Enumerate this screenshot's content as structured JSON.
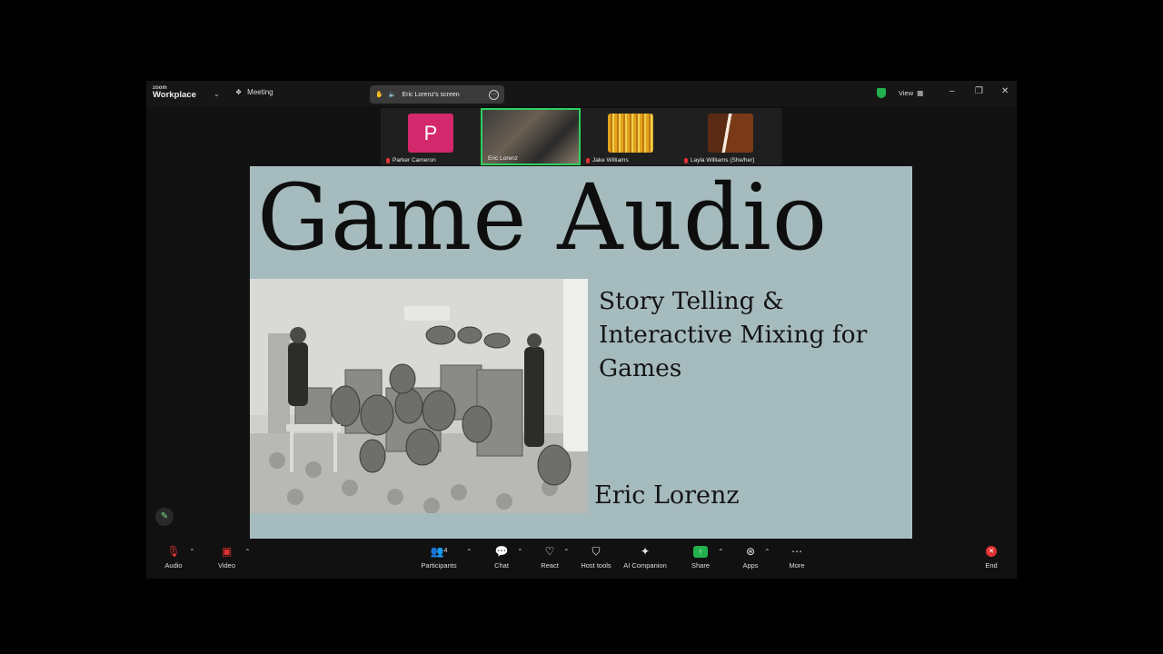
{
  "app": {
    "logo_top": "zoom",
    "logo_bottom": "Workplace",
    "meeting_label": "Meeting"
  },
  "share_pill": {
    "label": "Eric Lorenz's screen"
  },
  "view": {
    "label": "View"
  },
  "participants": [
    {
      "name": "Parker Cameron",
      "initial": "P",
      "muted": true
    },
    {
      "name": "Eric Lorenz",
      "muted": false,
      "active": true
    },
    {
      "name": "Jake Williams",
      "muted": true
    },
    {
      "name": "Layla Williams (She/her)",
      "muted": true
    }
  ],
  "slide": {
    "title": "Game Audio",
    "subtitle": "Story Telling & Interactive Mixing for Games",
    "author": "Eric Lorenz"
  },
  "toolbar": {
    "audio": "Audio",
    "video": "Video",
    "participants": "Participants",
    "participants_count": "4",
    "chat": "Chat",
    "react": "React",
    "host_tools": "Host tools",
    "ai_companion": "AI Companion",
    "share": "Share",
    "apps": "Apps",
    "more": "More",
    "end": "End"
  },
  "colors": {
    "accent_green": "#22b14c",
    "end_red": "#e03131",
    "slide_bg": "#a6bbbe"
  }
}
